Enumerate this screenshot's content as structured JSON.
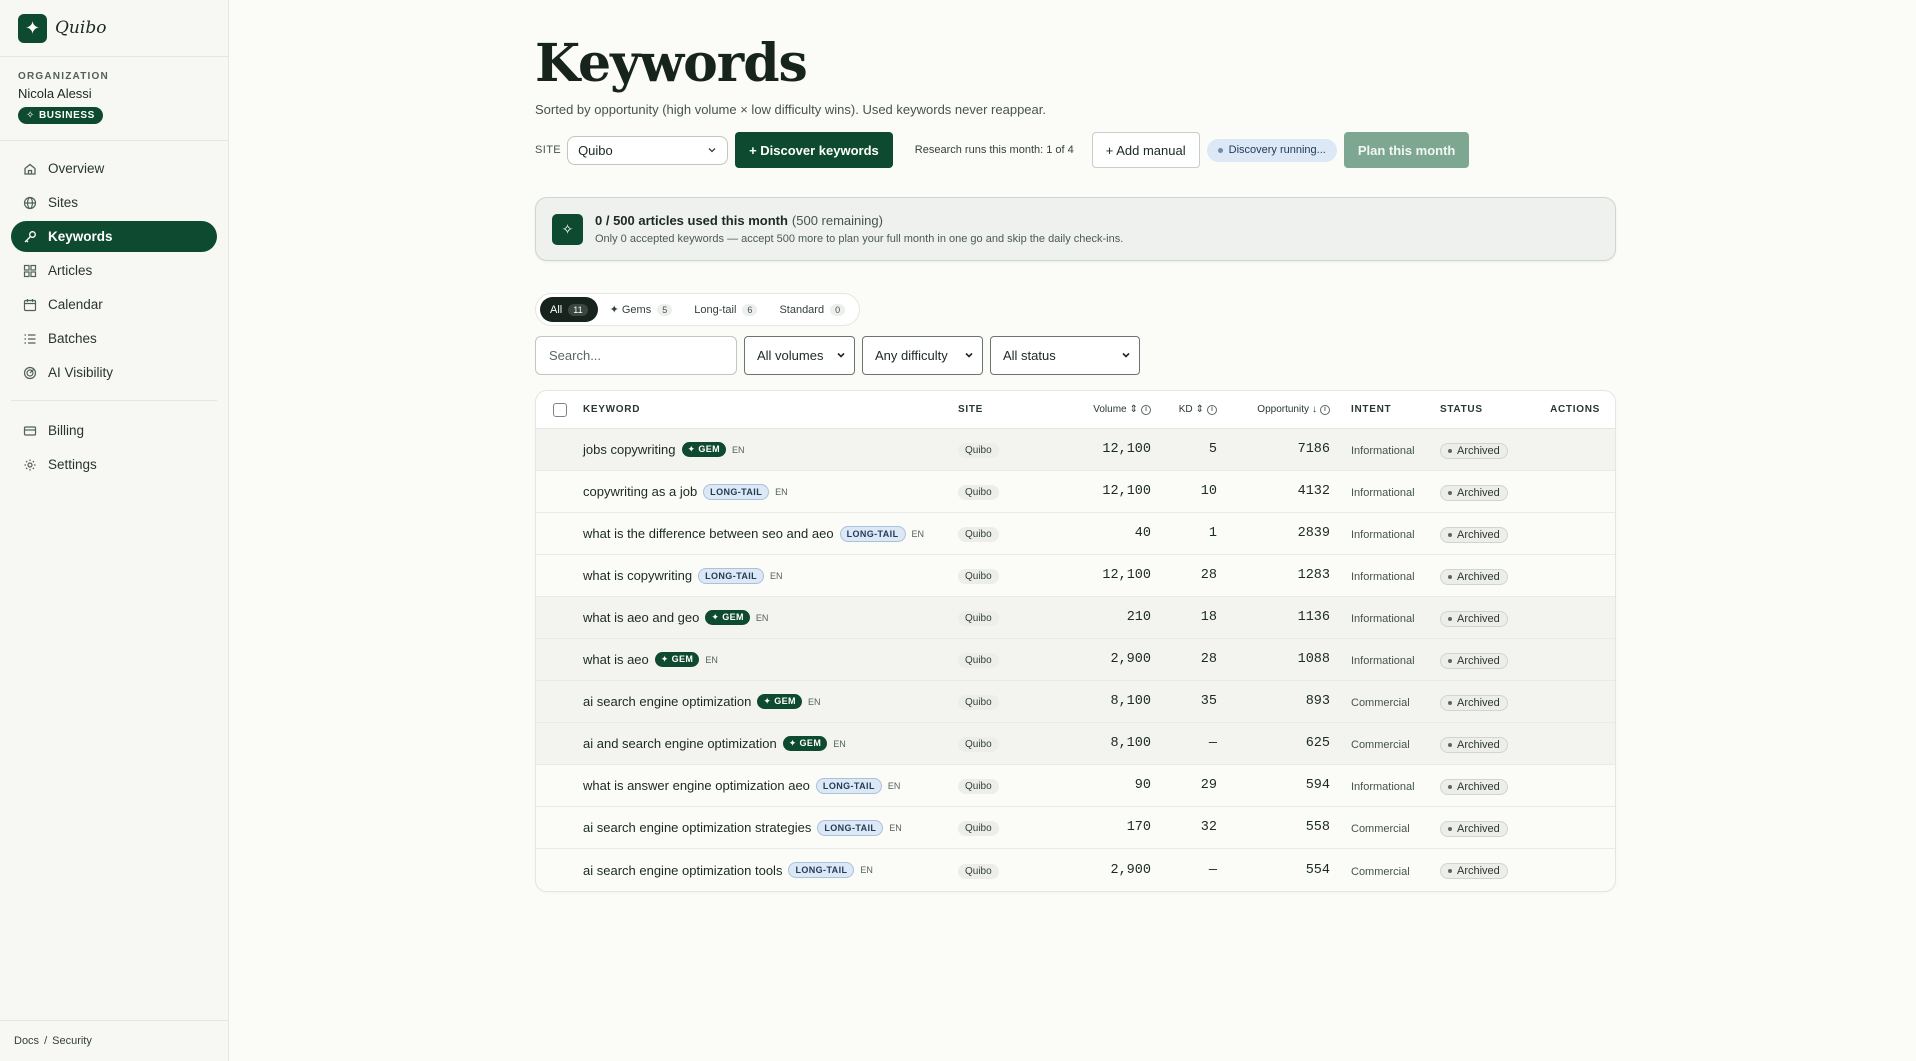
{
  "brand": {
    "name": "Quibo"
  },
  "org": {
    "label": "ORGANIZATION",
    "name": "Nicola Alessi",
    "plan": "BUSINESS"
  },
  "nav": {
    "items": [
      {
        "label": "Overview",
        "icon": "home-icon"
      },
      {
        "label": "Sites",
        "icon": "globe-icon"
      },
      {
        "label": "Keywords",
        "icon": "key-icon",
        "active": true
      },
      {
        "label": "Articles",
        "icon": "grid-icon"
      },
      {
        "label": "Calendar",
        "icon": "calendar-icon"
      },
      {
        "label": "Batches",
        "icon": "list-icon"
      },
      {
        "label": "AI Visibility",
        "icon": "radar-icon"
      }
    ],
    "secondary": [
      {
        "label": "Billing",
        "icon": "card-icon"
      },
      {
        "label": "Settings",
        "icon": "gear-icon"
      }
    ]
  },
  "footer": {
    "docs": "Docs",
    "sep": "/",
    "security": "Security"
  },
  "page": {
    "title": "Keywords",
    "subtitle": "Sorted by opportunity (high volume × low difficulty wins). Used keywords never reappear."
  },
  "toolbar": {
    "site_label": "SITE",
    "site_value": "Quibo",
    "discover_label": "+ Discover keywords",
    "runs_text": "Research runs this month: 1 of 4",
    "add_manual_label": "+ Add manual",
    "running_label": "Discovery running...",
    "plan_label": "Plan this month"
  },
  "usage": {
    "headline": "0 / 500 articles used this month",
    "remaining": "(500 remaining)",
    "detail": "Only 0 accepted keywords — accept 500 more to plan your full month in one go and skip the daily check-ins."
  },
  "segments": [
    {
      "label": "All",
      "count": "11",
      "active": true
    },
    {
      "label": "✦ Gems",
      "count": "5"
    },
    {
      "label": "Long-tail",
      "count": "6"
    },
    {
      "label": "Standard",
      "count": "0"
    }
  ],
  "filters": {
    "search_placeholder": "Search...",
    "volume": "All volumes",
    "difficulty": "Any difficulty",
    "status": "All status"
  },
  "table": {
    "headers": {
      "keyword": "KEYWORD",
      "site": "SITE",
      "volume": "Volume",
      "kd": "KD",
      "opportunity": "Opportunity",
      "intent": "INTENT",
      "status": "STATUS",
      "actions": "ACTIONS"
    },
    "rows": [
      {
        "keyword": "jobs copywriting",
        "tag": "✦ GEM",
        "type": "gem",
        "lang": "EN",
        "site": "Quibo",
        "volume": "12,100",
        "kd": "5",
        "opportunity": "7186",
        "intent": "Informational",
        "status": "Archived"
      },
      {
        "keyword": "copywriting as a job",
        "tag": "LONG-TAIL",
        "type": "lt",
        "lang": "EN",
        "site": "Quibo",
        "volume": "12,100",
        "kd": "10",
        "opportunity": "4132",
        "intent": "Informational",
        "status": "Archived"
      },
      {
        "keyword": "what is the difference between seo and aeo",
        "tag": "LONG-TAIL",
        "type": "lt",
        "lang": "EN",
        "site": "Quibo",
        "volume": "40",
        "kd": "1",
        "opportunity": "2839",
        "intent": "Informational",
        "status": "Archived"
      },
      {
        "keyword": "what is copywriting",
        "tag": "LONG-TAIL",
        "type": "lt",
        "lang": "EN",
        "site": "Quibo",
        "volume": "12,100",
        "kd": "28",
        "opportunity": "1283",
        "intent": "Informational",
        "status": "Archived"
      },
      {
        "keyword": "what is aeo and geo",
        "tag": "✦ GEM",
        "type": "gem",
        "lang": "EN",
        "site": "Quibo",
        "volume": "210",
        "kd": "18",
        "opportunity": "1136",
        "intent": "Informational",
        "status": "Archived"
      },
      {
        "keyword": "what is aeo",
        "tag": "✦ GEM",
        "type": "gem",
        "lang": "EN",
        "site": "Quibo",
        "volume": "2,900",
        "kd": "28",
        "opportunity": "1088",
        "intent": "Informational",
        "status": "Archived"
      },
      {
        "keyword": "ai search engine optimization",
        "tag": "✦ GEM",
        "type": "gem",
        "lang": "EN",
        "site": "Quibo",
        "volume": "8,100",
        "kd": "35",
        "opportunity": "893",
        "intent": "Commercial",
        "status": "Archived"
      },
      {
        "keyword": "ai and search engine optimization",
        "tag": "✦ GEM",
        "type": "gem",
        "lang": "EN",
        "site": "Quibo",
        "volume": "8,100",
        "kd": "—",
        "opportunity": "625",
        "intent": "Commercial",
        "status": "Archived"
      },
      {
        "keyword": "what is answer engine optimization aeo",
        "tag": "LONG-TAIL",
        "type": "lt",
        "lang": "EN",
        "site": "Quibo",
        "volume": "90",
        "kd": "29",
        "opportunity": "594",
        "intent": "Informational",
        "status": "Archived"
      },
      {
        "keyword": "ai search engine optimization strategies",
        "tag": "LONG-TAIL",
        "type": "lt",
        "lang": "EN",
        "site": "Quibo",
        "volume": "170",
        "kd": "32",
        "opportunity": "558",
        "intent": "Commercial",
        "status": "Archived"
      },
      {
        "keyword": "ai search engine optimization tools",
        "tag": "LONG-TAIL",
        "type": "lt",
        "lang": "EN",
        "site": "Quibo",
        "volume": "2,900",
        "kd": "—",
        "opportunity": "554",
        "intent": "Commercial",
        "status": "Archived"
      }
    ]
  }
}
